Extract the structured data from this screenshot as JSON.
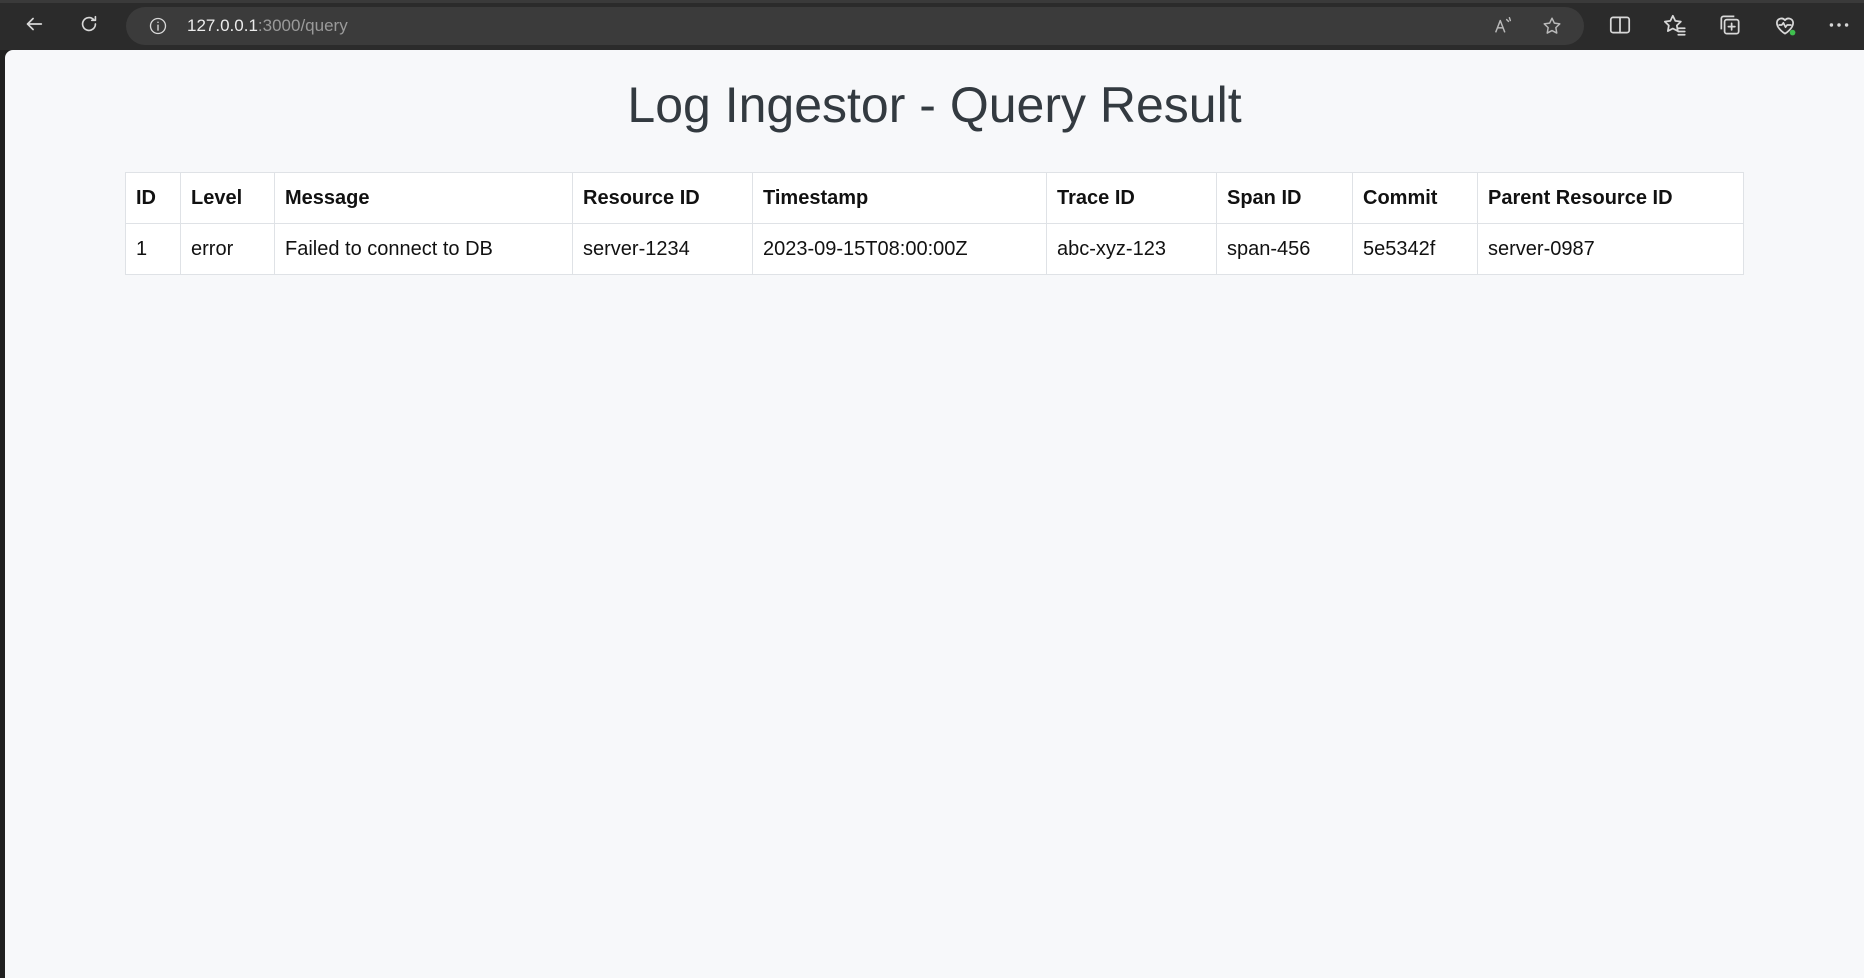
{
  "browser": {
    "url_host": "127.0.0.1",
    "url_path": ":3000/query",
    "icons": [
      "back-arrow-icon",
      "refresh-icon",
      "info-icon",
      "read-aloud-icon",
      "favorite-star-icon",
      "split-screen-icon",
      "favorites-icon",
      "collections-icon",
      "browser-essentials-icon",
      "more-icon"
    ]
  },
  "page": {
    "title": "Log Ingestor - Query Result"
  },
  "table": {
    "headers": [
      "ID",
      "Level",
      "Message",
      "Resource ID",
      "Timestamp",
      "Trace ID",
      "Span ID",
      "Commit",
      "Parent Resource ID"
    ],
    "rows": [
      [
        "1",
        "error",
        "Failed to connect to DB",
        "server-1234",
        "2023-09-15T08:00:00Z",
        "abc-xyz-123",
        "span-456",
        "5e5342f",
        "server-0987"
      ]
    ]
  },
  "colors": {
    "toolbar": "#2b2b2b",
    "address_bar": "#3b3b3b",
    "page_background": "#f7f8fa",
    "title_text": "#333a40",
    "table_border": "#dfe2e6"
  }
}
